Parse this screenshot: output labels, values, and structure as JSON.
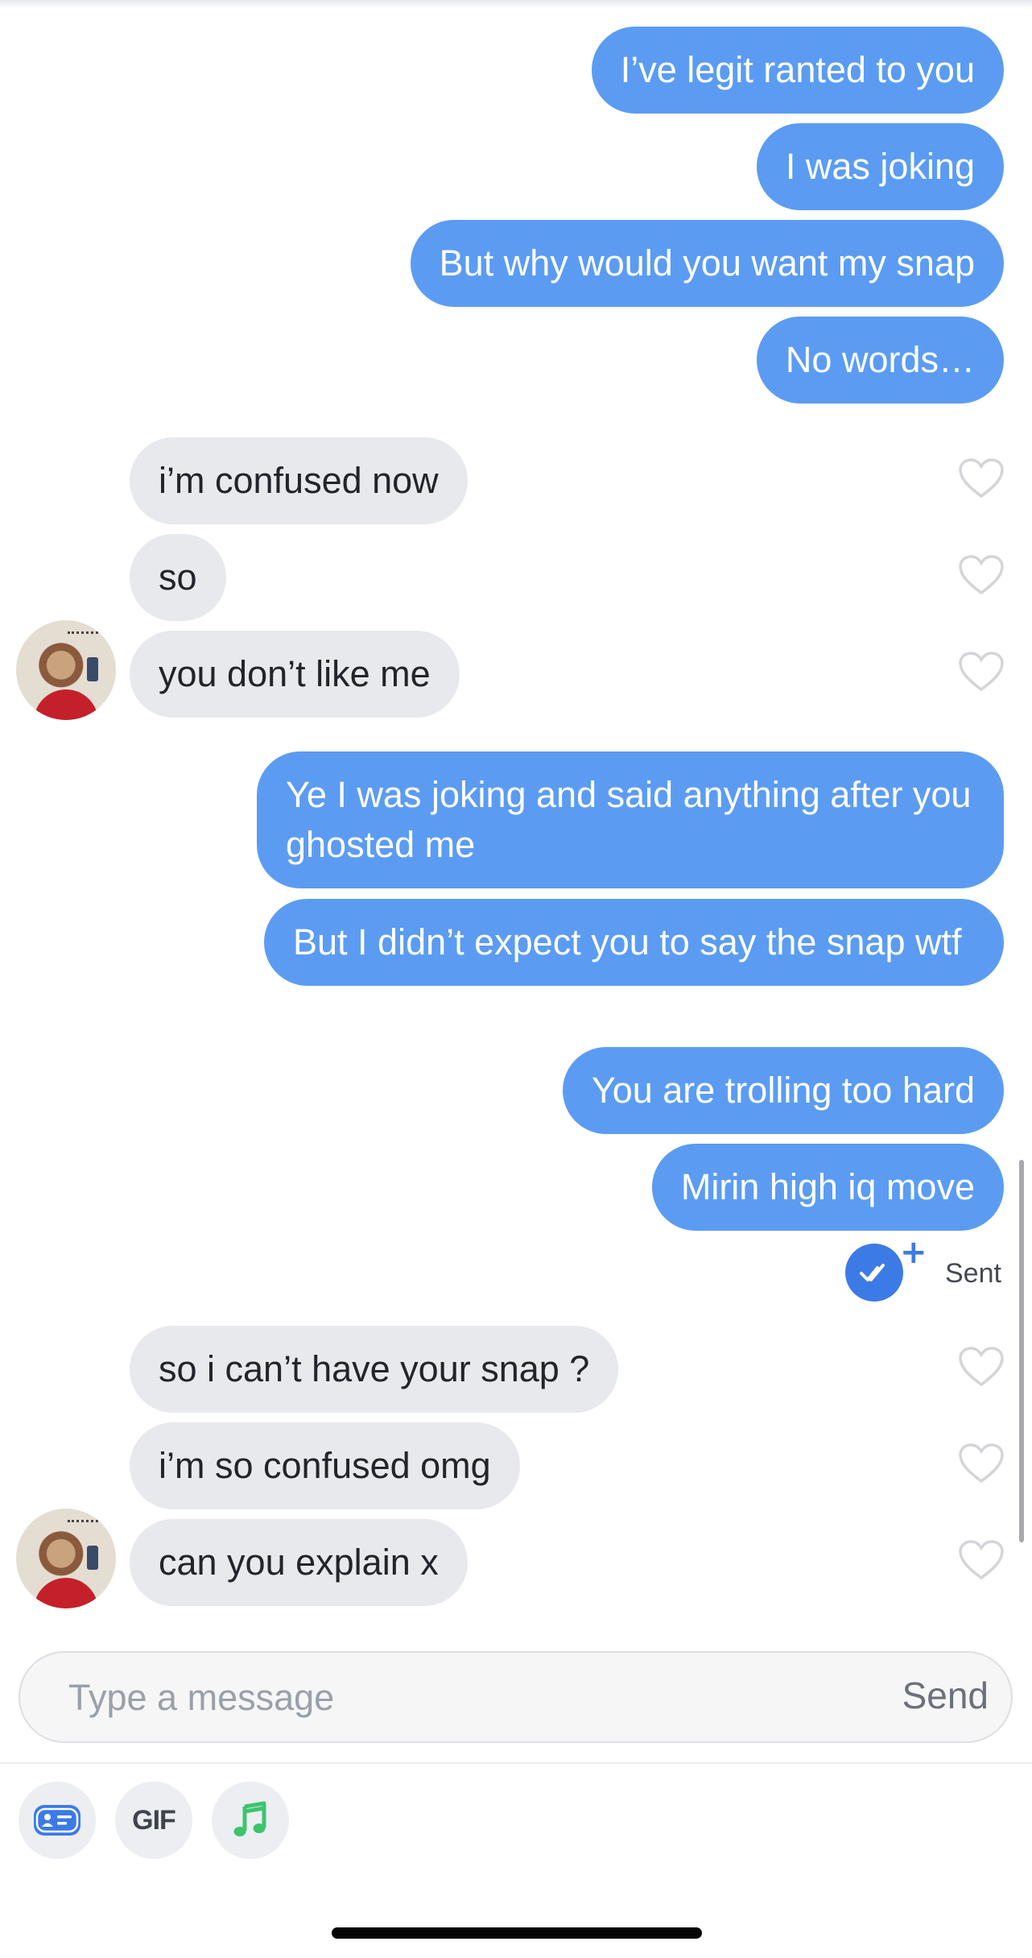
{
  "outgoing_group_1": [
    "I’ve legit ranted to you",
    "I was joking",
    "But why would you want my snap",
    "No words…"
  ],
  "incoming_group_1": [
    "i’m confused now",
    "so",
    "you don’t like me"
  ],
  "outgoing_group_2": [
    "Ye I was joking and said anything after you ghosted me",
    "But I didn’t expect you to say the snap wtf",
    "You are trolling too hard",
    "Mirin high iq move"
  ],
  "status": {
    "sent_label": "Sent",
    "plus_symbol": "+",
    "read_icon": "double-check-icon",
    "accent_color": "#3c7ae6"
  },
  "incoming_group_2": [
    "so i can’t have your snap ?",
    "i’m so confused omg",
    "can you explain x"
  ],
  "composer": {
    "placeholder": "Type a message",
    "value": "",
    "send_label": "Send"
  },
  "toolbar": {
    "gif_label": "GIF",
    "items": [
      "card-icon",
      "gif-button",
      "music-note-icon"
    ]
  },
  "colors": {
    "outgoing_bubble": "#5b9cf2",
    "incoming_bubble": "#e8e9ed",
    "music_icon": "#3ec46d"
  }
}
